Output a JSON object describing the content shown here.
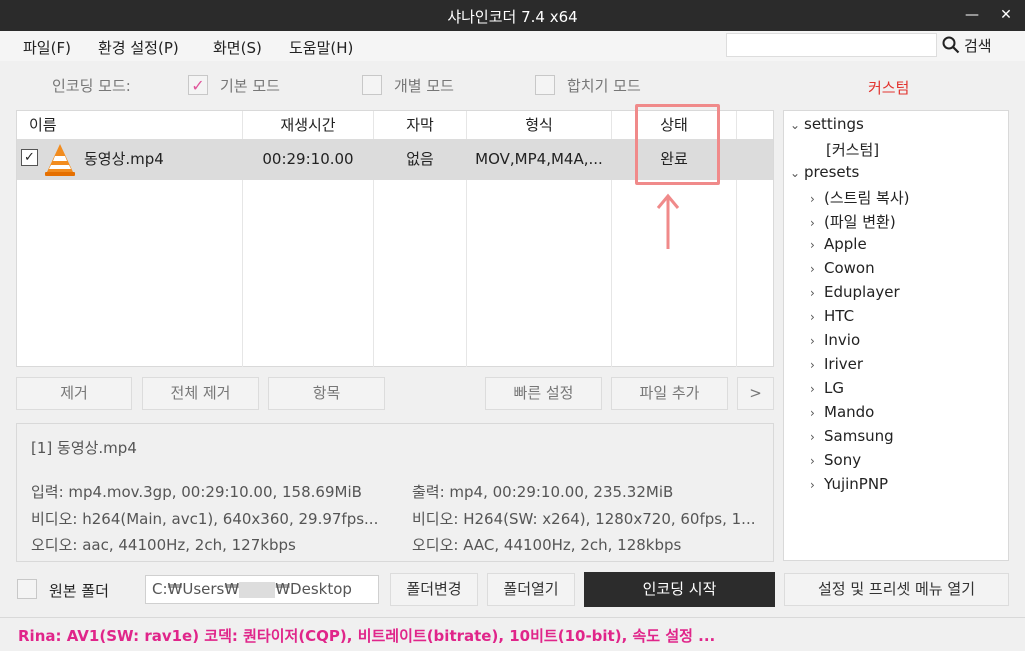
{
  "window": {
    "title": "샤나인코더  7.4 x64",
    "minimize": "—",
    "close": "✕"
  },
  "menu": [
    "파일(F)",
    "환경 설정(P)",
    "화면(S)",
    "도움말(H)"
  ],
  "search": {
    "placeholder": "",
    "button": "검색"
  },
  "encoding_mode": {
    "label": "인코딩 모드:",
    "options": [
      {
        "label": "기본 모드",
        "checked": true
      },
      {
        "label": "개별 모드",
        "checked": false
      },
      {
        "label": "합치기 모드",
        "checked": false
      }
    ]
  },
  "custom_label": "커스텀",
  "table": {
    "headers": [
      "이름",
      "재생시간",
      "자막",
      "형식",
      "상태"
    ],
    "rows": [
      {
        "checked": true,
        "name": "동영상.mp4",
        "duration": "00:29:10.00",
        "subtitle": "없음",
        "format": "MOV,MP4,M4A,...",
        "status": "완료"
      }
    ]
  },
  "list_buttons": [
    "제거",
    "전체 제거",
    "항목",
    "빠른 설정",
    "파일 추가",
    ">"
  ],
  "info": {
    "title": "[1] 동영상.mp4",
    "input": "입력: mp4.mov.3gp, 00:29:10.00, 158.69MiB",
    "input_video": "비디오: h264(Main, avc1), 640x360, 29.97fps...",
    "input_audio": "오디오: aac, 44100Hz, 2ch, 127kbps",
    "output": "출력: mp4, 00:29:10.00, 235.32MiB",
    "output_video": "비디오: H264(SW: x264), 1280x720, 60fps, 1...",
    "output_audio": "오디오: AAC, 44100Hz, 2ch, 128kbps"
  },
  "tree": {
    "settings": "settings",
    "settings_child": "[커스텀]",
    "presets": "presets",
    "preset_items": [
      "(스트림 복사)",
      "(파일 변환)",
      "Apple",
      "Cowon",
      "Eduplayer",
      "HTC",
      "Invio",
      "Iriver",
      "LG",
      "Mando",
      "Samsung",
      "Sony",
      "YujinPNP"
    ]
  },
  "bottom": {
    "original_folder_label": "원본 폴더",
    "path_prefix": "C:₩Users₩",
    "path_suffix": "₩Desktop",
    "change_folder": "폴더변경",
    "open_folder": "폴더열기",
    "start": "인코딩 시작",
    "settings_menu": "설정 및 프리셋 메뉴 열기"
  },
  "status": "Rina: AV1(SW: rav1e) 코덱: 퀀타이저(CQP), 비트레이트(bitrate), 10비트(10-bit), 속도 설정 ..."
}
